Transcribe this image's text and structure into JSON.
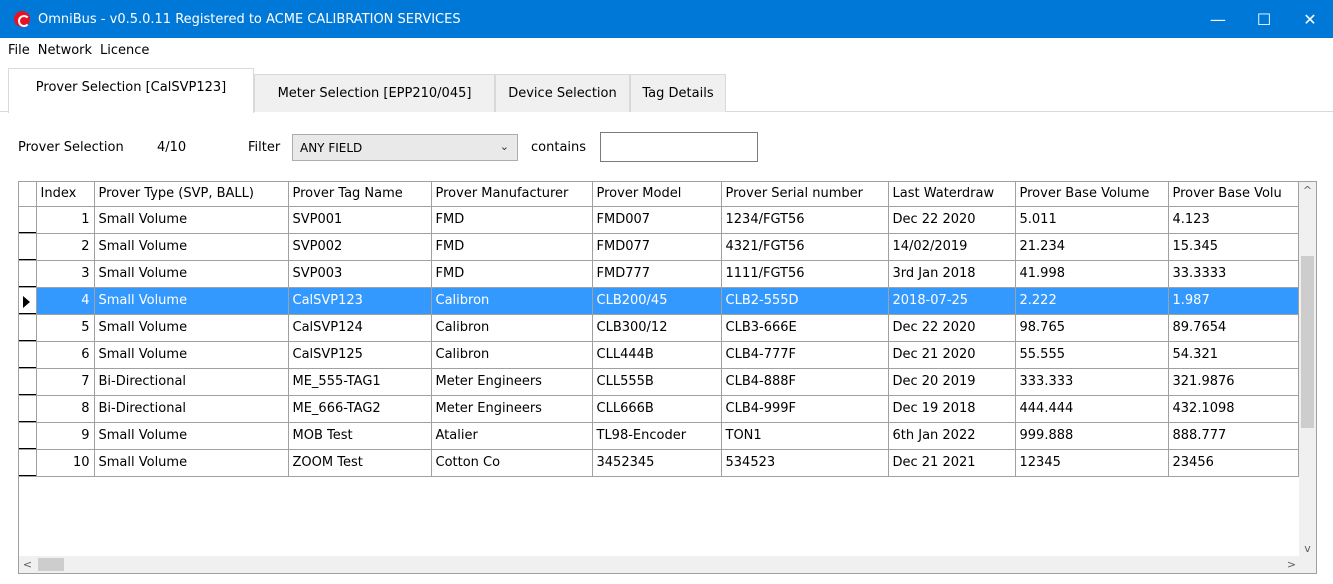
{
  "window": {
    "title": "OmniBus - v0.5.0.11  Registered to ACME CALIBRATION SERVICES",
    "minimize_glyph": "—",
    "maximize_glyph": "☐",
    "close_glyph": "✕"
  },
  "menu": {
    "items": [
      "File",
      "Network",
      "Licence"
    ]
  },
  "tabs": [
    {
      "label": "Prover Selection [CalSVP123]",
      "active": true
    },
    {
      "label": "Meter Selection [EPP210/045]",
      "active": false
    },
    {
      "label": "Device Selection",
      "active": false
    },
    {
      "label": "Tag Details",
      "active": false
    }
  ],
  "filter": {
    "section_label": "Prover Selection",
    "count": "4/10",
    "filter_label": "Filter",
    "field_value": "ANY FIELD",
    "contains_label": "contains",
    "contains_value": ""
  },
  "grid": {
    "columns": [
      "Index",
      "Prover Type (SVP, BALL)",
      "Prover Tag Name",
      "Prover Manufacturer",
      "Prover Model",
      "Prover Serial number",
      "Last Waterdraw",
      "Prover Base Volume",
      "Prover Base Volu"
    ],
    "selected_row": 3,
    "rows": [
      [
        "1",
        "Small Volume",
        "SVP001",
        "FMD",
        "FMD007",
        "1234/FGT56",
        "Dec 22 2020",
        "5.011",
        "4.123"
      ],
      [
        "2",
        "Small Volume",
        "SVP002",
        "FMD",
        "FMD077",
        "4321/FGT56",
        "14/02/2019",
        "21.234",
        "15.345"
      ],
      [
        "3",
        "Small Volume",
        "SVP003",
        "FMD",
        "FMD777",
        "1111/FGT56",
        "3rd Jan 2018",
        "41.998",
        "33.3333"
      ],
      [
        "4",
        "Small Volume",
        "CalSVP123",
        "Calibron",
        "CLB200/45",
        "CLB2-555D",
        "2018-07-25",
        "2.222",
        "1.987"
      ],
      [
        "5",
        "Small Volume",
        "CalSVP124",
        "Calibron",
        "CLB300/12",
        "CLB3-666E",
        "Dec 22 2020",
        "98.765",
        "89.7654"
      ],
      [
        "6",
        "Small Volume",
        "CalSVP125",
        "Calibron",
        "CLL444B",
        "CLB4-777F",
        "Dec 21 2020",
        "55.555",
        "54.321"
      ],
      [
        "7",
        "Bi-Directional",
        "ME_555-TAG1",
        "Meter Engineers",
        "CLL555B",
        "CLB4-888F",
        "Dec 20 2019",
        "333.333",
        "321.9876"
      ],
      [
        "8",
        "Bi-Directional",
        "ME_666-TAG2",
        "Meter Engineers",
        "CLL666B",
        "CLB4-999F",
        "Dec 19 2018",
        "444.444",
        "432.1098"
      ],
      [
        "9",
        "Small Volume",
        "MOB Test",
        "Atalier",
        "TL98-Encoder",
        "TON1",
        "6th Jan 2022",
        "999.888",
        "888.777"
      ],
      [
        "10",
        "Small Volume",
        "ZOOM Test",
        "Cotton Co",
        "3452345",
        "534523",
        "Dec 21 2021",
        "12345",
        "23456"
      ]
    ]
  },
  "scroll": {
    "up": "^",
    "down": "v",
    "left": "<",
    "right": ">"
  }
}
